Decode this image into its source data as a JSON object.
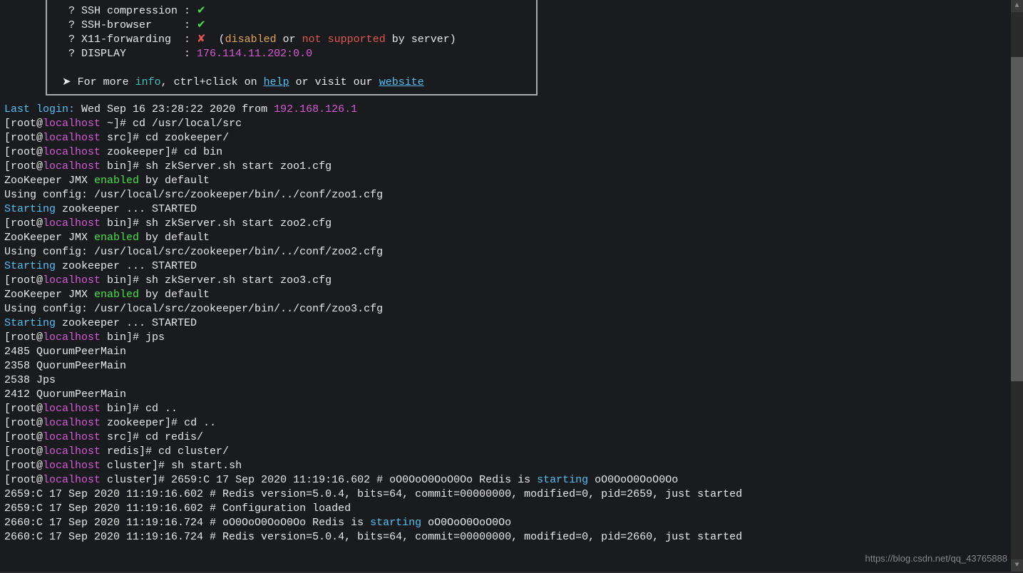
{
  "box": {
    "ssh_compression_label": "  ? SSH compression : ",
    "ssh_compression_mark": "✔",
    "ssh_browser_label": "  ? SSH-browser     : ",
    "ssh_browser_mark": "✔",
    "x11_label": "  ? X11-forwarding  : ",
    "x11_mark": "✘",
    "x11_open": "  (",
    "x11_disabled": "disabled",
    "x11_or": " or ",
    "x11_not_supported": "not supported",
    "x11_by_server": " by server)",
    "display_label": "  ? DISPLAY         : ",
    "display_value": "176.114.11.202:0.0",
    "more_arrow": " ➤ ",
    "more_text1": "For more ",
    "more_info": "info",
    "more_text2": ", ctrl+click on ",
    "help": "help",
    "more_text3": " or visit our ",
    "website": "website"
  },
  "l": {
    "last_login_lbl": "Last login:",
    "last_login_mid": " Wed Sep 16 23:28:22 2020 from ",
    "last_login_ip": "192.168.126.1",
    "p1_r": "[root@",
    "p1_h": "localhost",
    "p1_d": " ~]# ",
    "p1_c": "cd /usr/local/src",
    "p2_d": " src]# ",
    "p2_c": "cd zookeeper/",
    "p3_d": " zookeeper]# ",
    "p3_c": "cd bin",
    "p4_d": " bin]# ",
    "p4_c": "sh zkServer.sh start zoo1.cfg",
    "jmx1": "ZooKeeper JMX ",
    "enabled": "enabled",
    "jmx2": " by default",
    "cfg1": "Using config: /usr/local/src/zookeeper/bin/../conf/zoo1.cfg",
    "starting": "Starting",
    "zk_started": " zookeeper ... STARTED",
    "p5_c": "sh zkServer.sh start zoo2.cfg",
    "cfg2": "Using config: /usr/local/src/zookeeper/bin/../conf/zoo2.cfg",
    "p6_c": "sh zkServer.sh start zoo3.cfg",
    "cfg3": "Using config: /usr/local/src/zookeeper/bin/../conf/zoo3.cfg",
    "p7_c": "jps",
    "jps1": "2485 QuorumPeerMain",
    "jps2": "2358 QuorumPeerMain",
    "jps3": "2538 Jps",
    "jps4": "2412 QuorumPeerMain",
    "p8_c": "cd ..",
    "p9_d": " zookeeper]# ",
    "p9_c": "cd ..",
    "p10_d": " src]# ",
    "p10_c": "cd redis/",
    "p11_d": " redis]# ",
    "p11_c": "cd cluster/",
    "p12_d": " cluster]# ",
    "p12_c": "sh start.sh",
    "p13_d": " cluster]# ",
    "r1a": "2659:C 17 Sep 2020 11:19:16.602 # oO0OoO0OoO0Oo Redis is ",
    "r_start": "starting",
    "r1b": " oO0OoO0OoO0Oo",
    "r2": "2659:C 17 Sep 2020 11:19:16.602 # Redis version=5.0.4, bits=64, commit=00000000, modified=0, pid=2659, just started",
    "r3": "2659:C 17 Sep 2020 11:19:16.602 # Configuration loaded",
    "r4a": "2660:C 17 Sep 2020 11:19:16.724 # oO0OoO0OoO0Oo Redis is ",
    "r4b": " oO0OoO0OoO0Oo",
    "r5": "2660:C 17 Sep 2020 11:19:16.724 # Redis version=5.0.4, bits=64, commit=00000000, modified=0, pid=2660, just started"
  },
  "watermark": "https://blog.csdn.net/qq_43765888"
}
